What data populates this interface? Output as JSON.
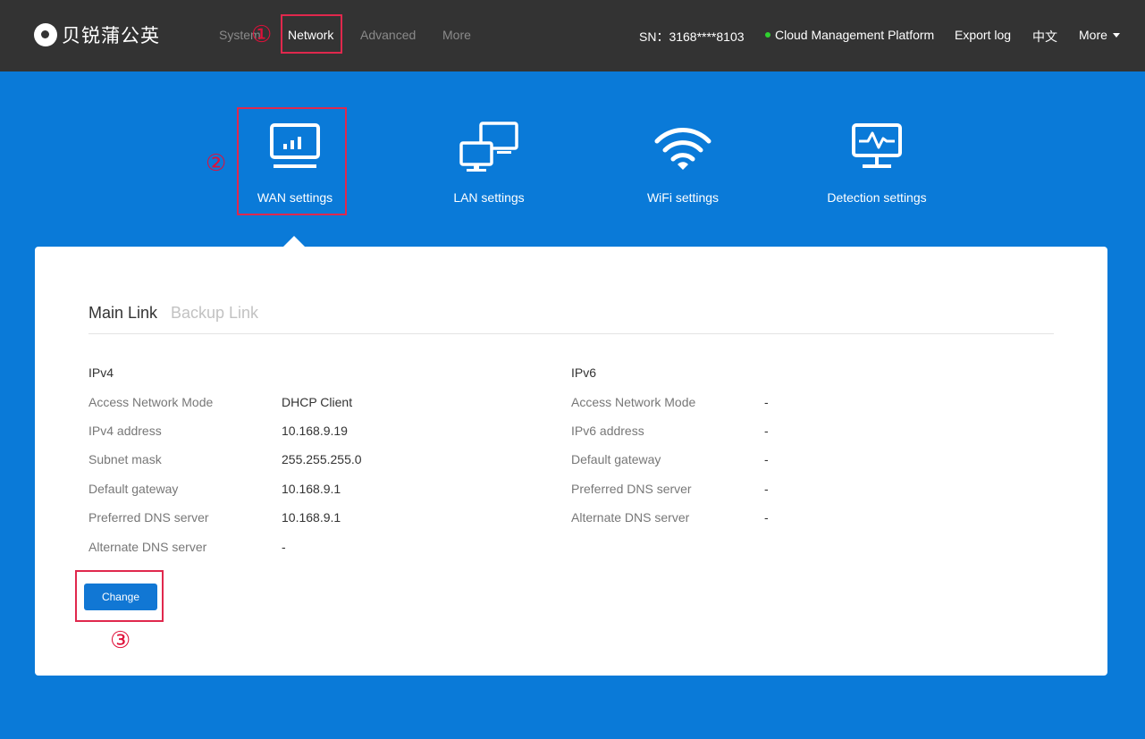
{
  "brand": {
    "name": "贝锐蒲公英"
  },
  "nav": {
    "items": [
      {
        "label": "System"
      },
      {
        "label": "Network"
      },
      {
        "label": "Advanced"
      },
      {
        "label": "More"
      }
    ]
  },
  "header_right": {
    "sn": "SN：3168****8103",
    "cloud": "Cloud Management Platform",
    "export": "Export log",
    "lang": "中文",
    "more": "More"
  },
  "annotations": {
    "one": "①",
    "two": "②",
    "three": "③",
    "color": "#e0284d"
  },
  "categories": [
    {
      "label": "WAN settings",
      "icon": "monitor-chart-icon"
    },
    {
      "label": "LAN settings",
      "icon": "network-screens-icon"
    },
    {
      "label": "WiFi settings",
      "icon": "wifi-icon"
    },
    {
      "label": "Detection settings",
      "icon": "monitor-pulse-icon"
    }
  ],
  "tabs": {
    "main": "Main Link",
    "backup": "Backup Link"
  },
  "ipv4": {
    "title": "IPv4",
    "rows": [
      {
        "label": "Access Network Mode",
        "value": "DHCP Client"
      },
      {
        "label": "IPv4 address",
        "value": "10.168.9.19"
      },
      {
        "label": "Subnet mask",
        "value": "255.255.255.0"
      },
      {
        "label": "Default gateway",
        "value": "10.168.9.1"
      },
      {
        "label": "Preferred DNS server",
        "value": "10.168.9.1"
      },
      {
        "label": "Alternate DNS server",
        "value": "-"
      }
    ]
  },
  "ipv6": {
    "title": "IPv6",
    "rows": [
      {
        "label": "Access Network Mode",
        "value": "-"
      },
      {
        "label": "IPv6 address",
        "value": "-"
      },
      {
        "label": "Default gateway",
        "value": "-"
      },
      {
        "label": "Preferred DNS server",
        "value": "-"
      },
      {
        "label": "Alternate DNS server",
        "value": "-"
      }
    ]
  },
  "actions": {
    "change": "Change"
  },
  "colors": {
    "topbar": "#333333",
    "background": "#0a7ad8",
    "button": "#1177d4",
    "status_online": "#2fd12f"
  }
}
